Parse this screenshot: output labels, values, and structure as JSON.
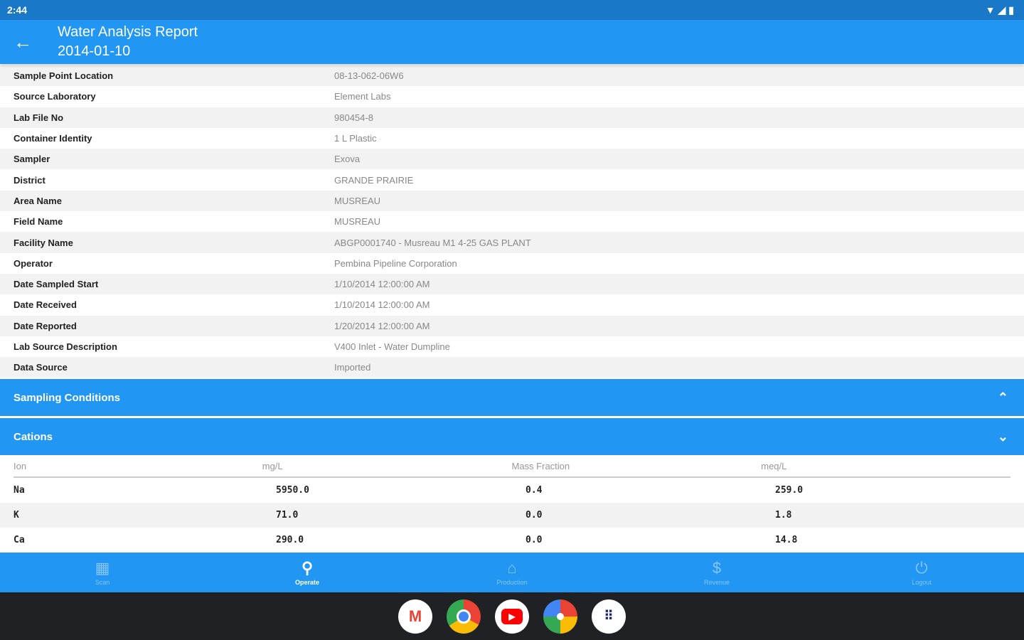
{
  "status_bar": {
    "time": "2:44"
  },
  "app_bar": {
    "title": "Water Analysis Report",
    "subtitle": "2014-01-10"
  },
  "details": [
    {
      "label": "Sample Point Location",
      "value": "08-13-062-06W6"
    },
    {
      "label": "Source Laboratory",
      "value": "Element Labs"
    },
    {
      "label": "Lab File No",
      "value": "980454-8"
    },
    {
      "label": "Container Identity",
      "value": "1 L Plastic"
    },
    {
      "label": "Sampler",
      "value": "Exova"
    },
    {
      "label": "District",
      "value": "GRANDE PRAIRIE"
    },
    {
      "label": "Area Name",
      "value": "MUSREAU"
    },
    {
      "label": "Field Name",
      "value": "MUSREAU"
    },
    {
      "label": "Facility Name",
      "value": "ABGP0001740 - Musreau M1 4-25 GAS PLANT"
    },
    {
      "label": "Operator",
      "value": "Pembina Pipeline Corporation"
    },
    {
      "label": "Date Sampled Start",
      "value": "1/10/2014 12:00:00 AM"
    },
    {
      "label": "Date Received",
      "value": "1/10/2014 12:00:00 AM"
    },
    {
      "label": "Date Reported",
      "value": "1/20/2014 12:00:00 AM"
    },
    {
      "label": "Lab Source Description",
      "value": "V400 Inlet - Water Dumpline"
    },
    {
      "label": "Data Source",
      "value": "Imported"
    }
  ],
  "sections": {
    "sampling_conditions": "Sampling Conditions",
    "cations": "Cations"
  },
  "cations_table": {
    "headers": [
      "Ion",
      "mg/L",
      "Mass Fraction",
      "meq/L"
    ],
    "rows": [
      [
        "Na",
        "5950.0",
        "0.4",
        "259.0"
      ],
      [
        "K",
        "71.0",
        "0.0",
        "1.8"
      ],
      [
        "Ca",
        "290.0",
        "0.0",
        "14.8"
      ]
    ]
  },
  "bottom_nav": [
    {
      "label": "Scan",
      "icon": "qr-code-icon"
    },
    {
      "label": "Operate",
      "icon": "search-icon"
    },
    {
      "label": "Production",
      "icon": "home-icon"
    },
    {
      "label": "Revenue",
      "icon": "dollar-icon"
    },
    {
      "label": "Logout",
      "icon": "power-icon"
    }
  ],
  "colors": {
    "primary": "#2196f3",
    "status_bar": "#1a78c8",
    "taskbar": "#202124"
  }
}
